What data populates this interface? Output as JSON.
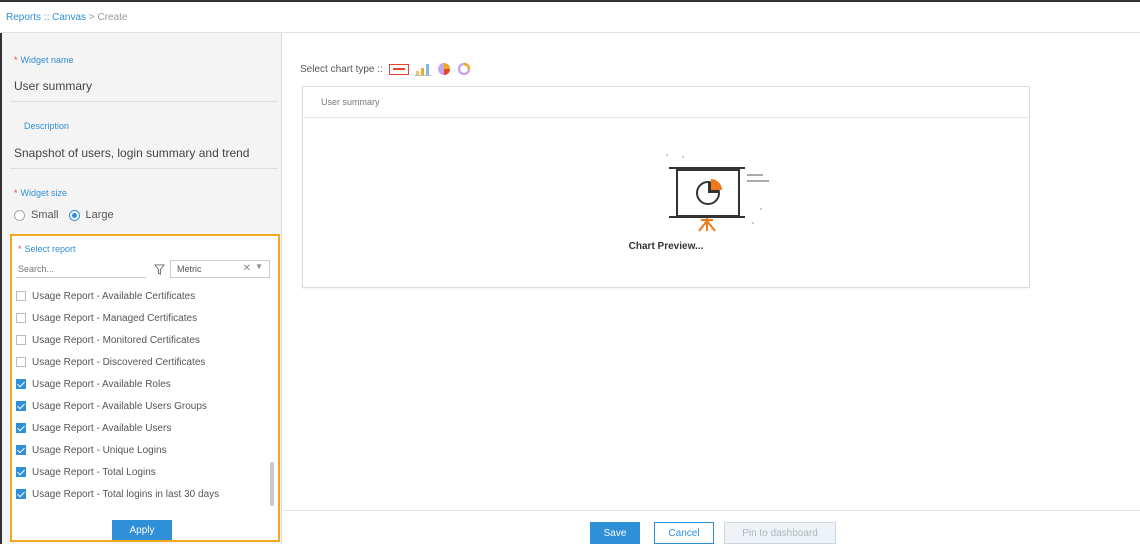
{
  "breadcrumb": {
    "reports": "Reports",
    "sep1": " :: ",
    "canvas": "Canvas",
    "sep2": " > ",
    "current": "Create"
  },
  "form": {
    "widget_name_label": "Widget name",
    "widget_name_value": "User summary",
    "description_label": "Description",
    "description_value": "Snapshot of users, login summary and trend",
    "widget_size_label": "Widget size",
    "size_options": [
      "Small",
      "Large"
    ],
    "selected_size": "Large",
    "select_report_label": "Select report",
    "search_placeholder": "Search...",
    "metric_value": "Metric",
    "reports": [
      {
        "label": "Usage Report - Available Certificates",
        "checked": false
      },
      {
        "label": "Usage Report - Managed Certificates",
        "checked": false
      },
      {
        "label": "Usage Report - Monitored Certificates",
        "checked": false
      },
      {
        "label": "Usage Report - Discovered Certificates",
        "checked": false
      },
      {
        "label": "Usage Report - Available Roles",
        "checked": true
      },
      {
        "label": "Usage Report - Available Users Groups",
        "checked": true
      },
      {
        "label": "Usage Report - Available Users",
        "checked": true
      },
      {
        "label": "Usage Report - Unique Logins",
        "checked": true
      },
      {
        "label": "Usage Report - Total Logins",
        "checked": true
      },
      {
        "label": "Usage Report - Total logins in last 30 days",
        "checked": true
      }
    ],
    "apply_label": "Apply"
  },
  "chart": {
    "select_type_label": "Select chart type ::",
    "type_icons": [
      "table-icon",
      "bar-chart-icon",
      "pie-chart-icon",
      "donut-chart-icon"
    ],
    "preview_title": "User summary",
    "preview_caption": "Chart Preview..."
  },
  "footer": {
    "save_label": "Save",
    "cancel_label": "Cancel",
    "pin_label": "Pin to dashboard"
  },
  "colors": {
    "accent": "#2f8fd8",
    "highlight": "#f2a81d",
    "illustration": "#f07a1a"
  }
}
